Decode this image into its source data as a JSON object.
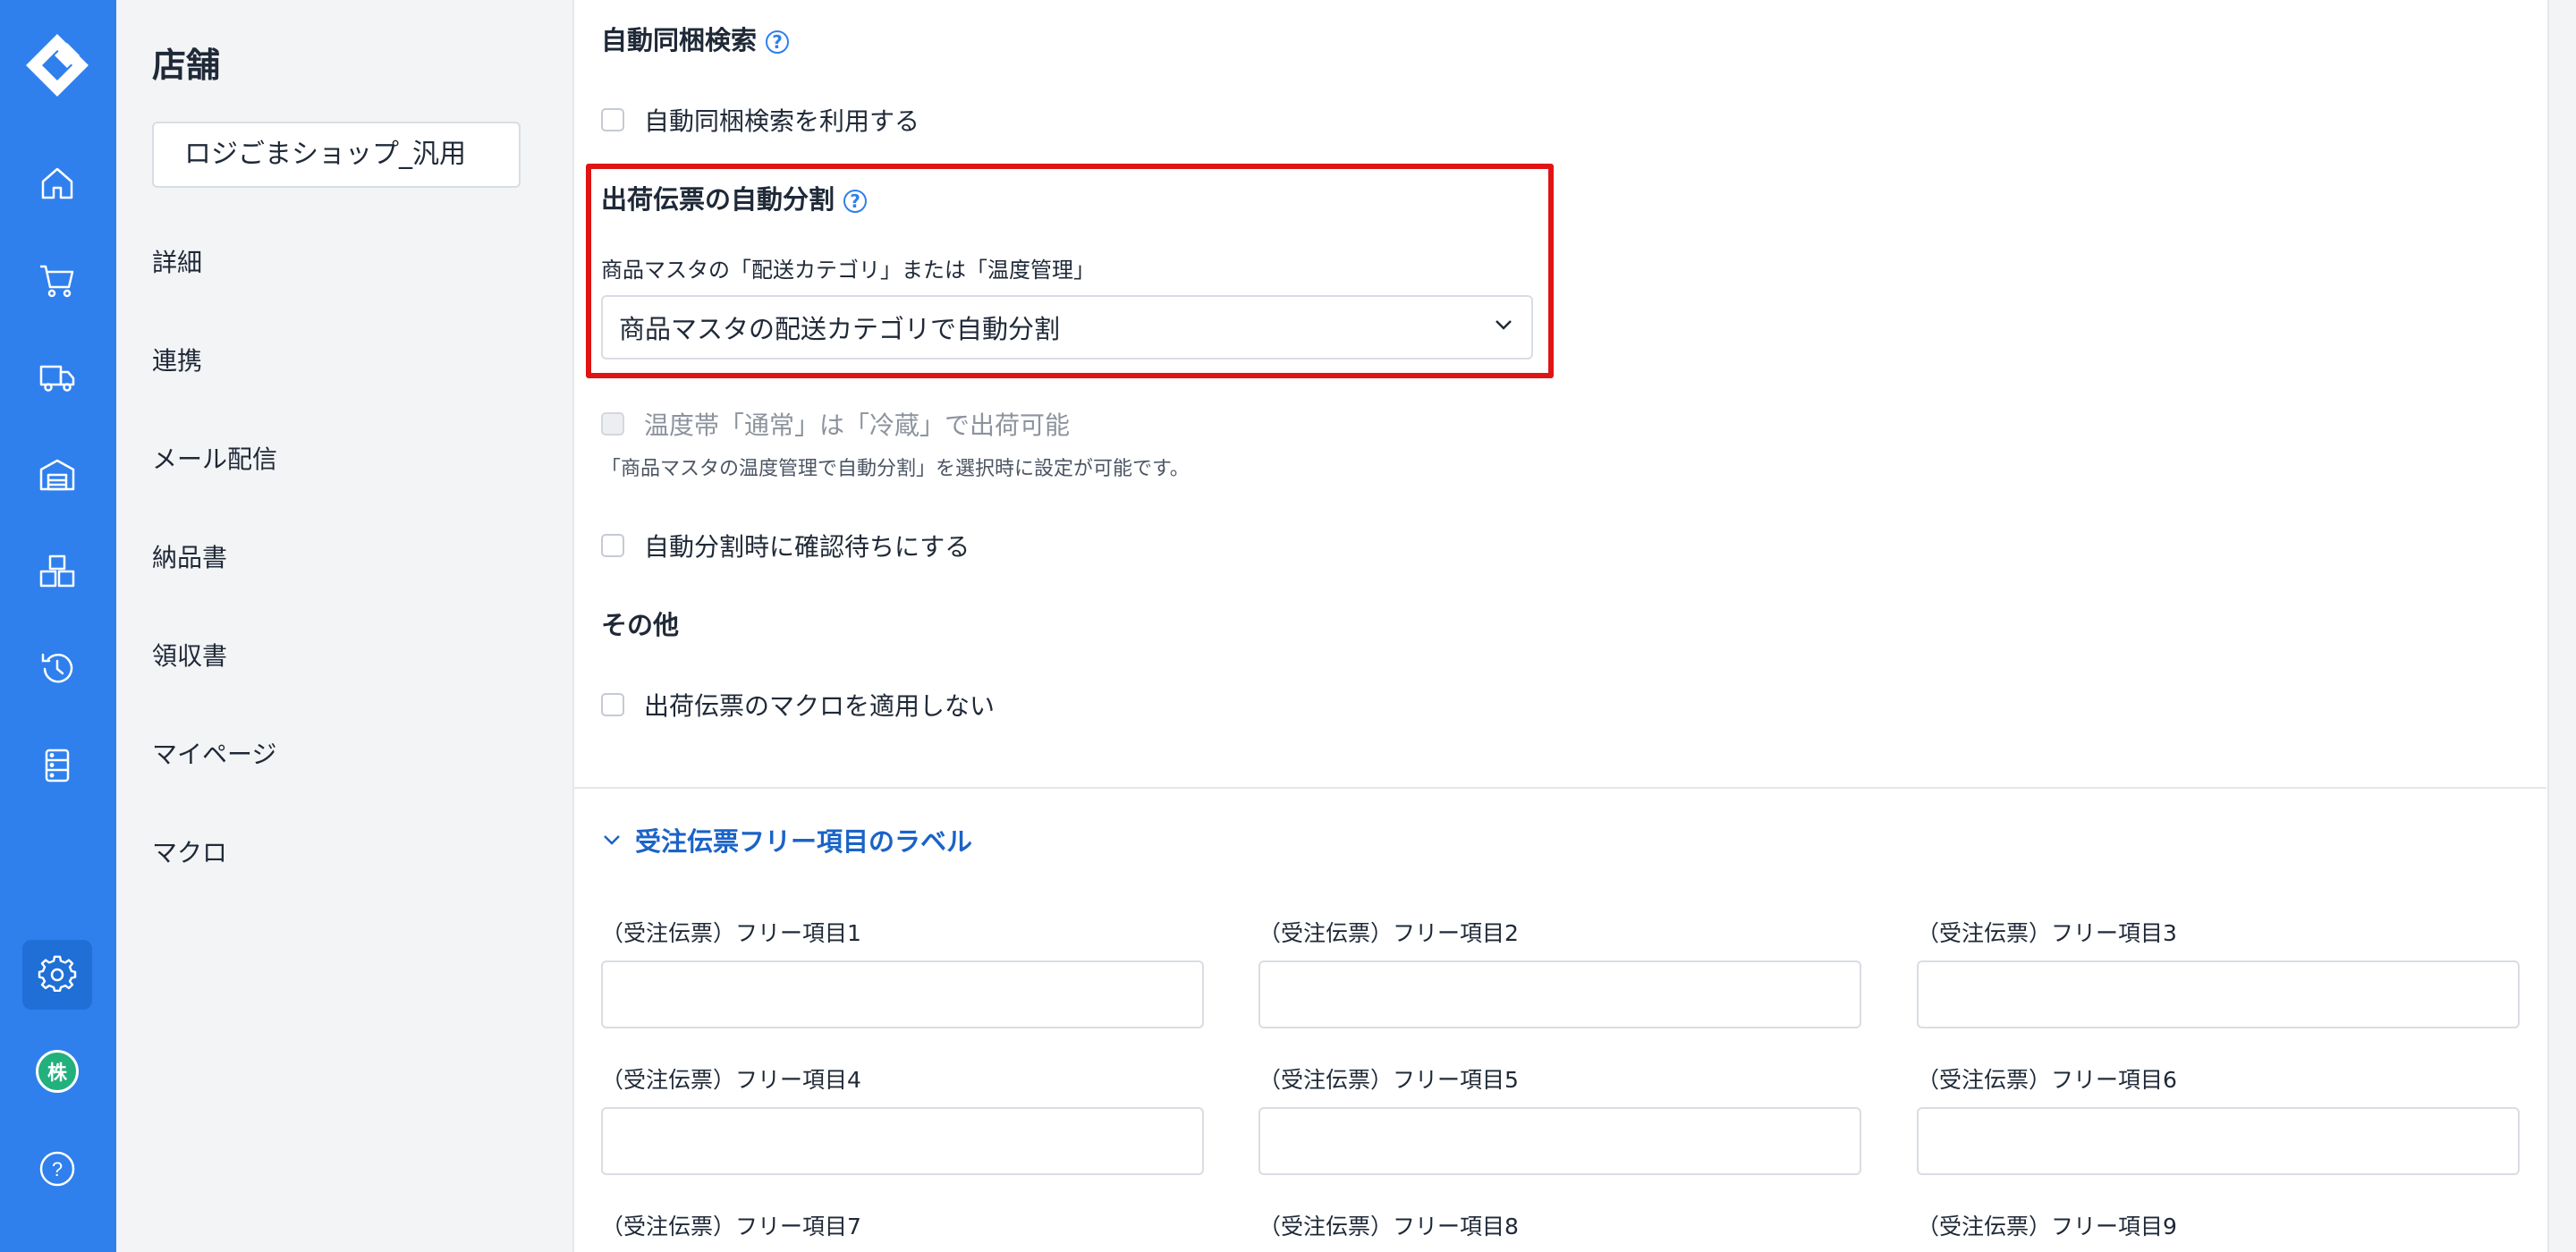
{
  "colors": {
    "rail": "#2f80ed",
    "accent": "#1a63c7",
    "highlight_border": "#e01414"
  },
  "rail": {
    "icons": [
      "logo-icon",
      "home-icon",
      "cart-icon",
      "truck-icon",
      "warehouse-icon",
      "boxes-icon",
      "history-icon",
      "server-icon",
      "gear-icon",
      "avatar",
      "help-icon"
    ],
    "avatar_text": "株",
    "help_text": "?"
  },
  "nav": {
    "title": "店舗",
    "store_value": "ロジごまショップ_汎用",
    "items": [
      "詳細",
      "連携",
      "メール配信",
      "納品書",
      "領収書",
      "マイページ",
      "マクロ"
    ]
  },
  "main": {
    "auto_bundle": {
      "title": "自動同梱検索",
      "help": "?",
      "checkbox_label": "自動同梱検索を利用する"
    },
    "auto_split": {
      "title": "出荷伝票の自動分割",
      "help": "?",
      "select_label": "商品マスタの「配送カテゴリ」または「温度管理」",
      "select_value": "商品マスタの配送カテゴリで自動分割"
    },
    "temp_checkbox_label": "温度帯「通常」は「冷蔵」で出荷可能",
    "temp_hint": "「商品マスタの温度管理で自動分割」を選択時に設定が可能です。",
    "confirm_checkbox_label": "自動分割時に確認待ちにする",
    "other": {
      "title": "その他",
      "macro_checkbox_label": "出荷伝票のマクロを適用しない"
    },
    "free_labels": {
      "title": "受注伝票フリー項目のラベル",
      "fields": [
        "（受注伝票）フリー項目1",
        "（受注伝票）フリー項目2",
        "（受注伝票）フリー項目3",
        "（受注伝票）フリー項目4",
        "（受注伝票）フリー項目5",
        "（受注伝票）フリー項目6",
        "（受注伝票）フリー項目7",
        "（受注伝票）フリー項目8",
        "（受注伝票）フリー項目9"
      ]
    }
  }
}
